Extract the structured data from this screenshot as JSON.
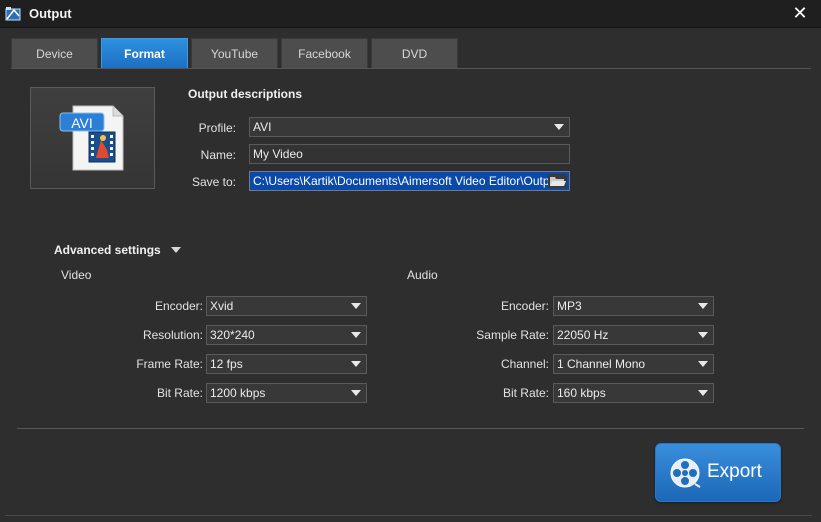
{
  "window": {
    "title": "Output",
    "close_glyph": "✕"
  },
  "tabs": [
    {
      "label": "Device",
      "active": false
    },
    {
      "label": "Format",
      "active": true
    },
    {
      "label": "YouTube",
      "active": false
    },
    {
      "label": "Facebook",
      "active": false
    },
    {
      "label": "DVD",
      "active": false
    }
  ],
  "format_icon": {
    "badge": "AVI",
    "icon": "avi-file-icon"
  },
  "output": {
    "title": "Output descriptions",
    "profile_label": "Profile:",
    "profile_value": "AVI",
    "name_label": "Name:",
    "name_value": "My Video",
    "save_label": "Save to:",
    "save_value": "C:\\Users\\Kartik\\Documents\\Aimersoft Video Editor\\Output\\"
  },
  "advanced": {
    "title": "Advanced settings",
    "video": {
      "title": "Video",
      "encoder_label": "Encoder:",
      "encoder_value": "Xvid",
      "resolution_label": "Resolution:",
      "resolution_value": "320*240",
      "framerate_label": "Frame Rate:",
      "framerate_value": "12 fps",
      "bitrate_label": "Bit Rate:",
      "bitrate_value": "1200 kbps"
    },
    "audio": {
      "title": "Audio",
      "encoder_label": "Encoder:",
      "encoder_value": "MP3",
      "samplerate_label": "Sample Rate:",
      "samplerate_value": "22050 Hz",
      "channel_label": "Channel:",
      "channel_value": "1 Channel Mono",
      "bitrate_label": "Bit Rate:",
      "bitrate_value": "160 kbps"
    }
  },
  "export": {
    "label": "Export",
    "icon": "film-reel-icon"
  },
  "colors": {
    "accent": "#1f74c8",
    "background": "#2e2e2e",
    "path_highlight": "#0a49a8"
  }
}
